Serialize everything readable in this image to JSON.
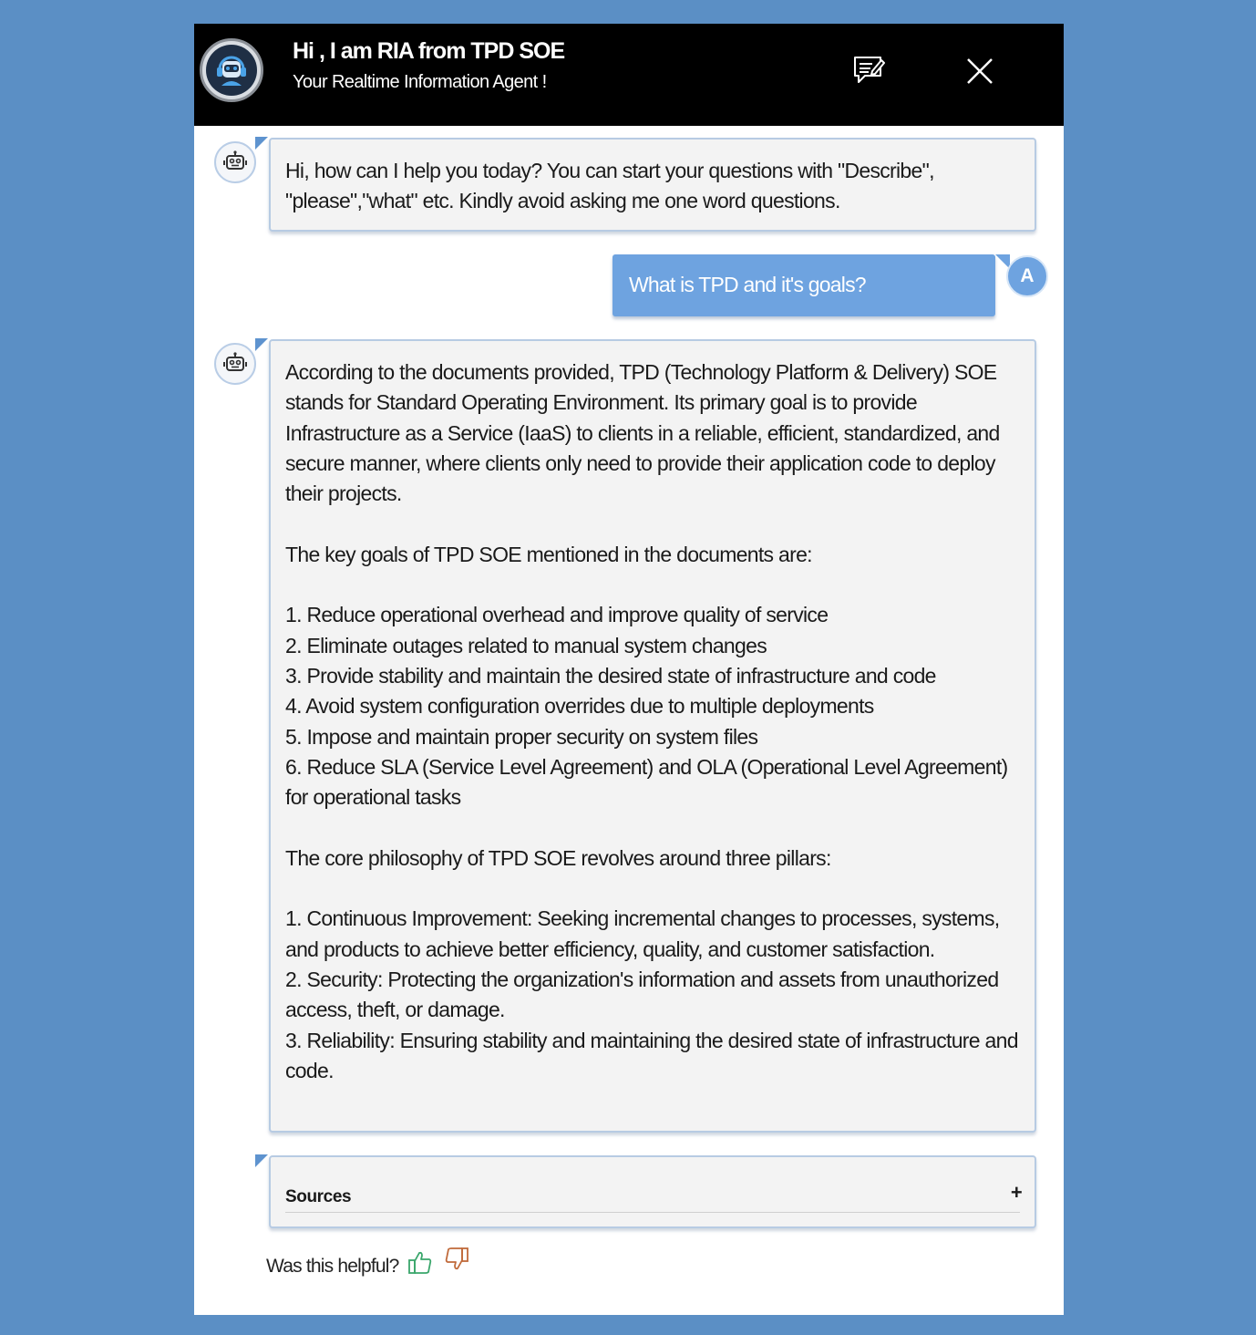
{
  "header": {
    "title": "Hi , I am RIA from TPD SOE",
    "subtitle": "Your Realtime Information Agent !"
  },
  "messages": {
    "greeting": "Hi, how can I help you today? You can start your questions with \"Describe\", \"please\",\"what\" etc. Kindly avoid asking me one word questions.",
    "user_question": "What is TPD and it's goals?",
    "user_avatar_letter": "A",
    "answer": "According to the documents provided, TPD (Technology Platform & Delivery) SOE stands for Standard Operating Environment. Its primary goal is to provide Infrastructure as a Service (IaaS) to clients in a reliable, efficient, standardized, and secure manner, where clients only need to provide their application code to deploy their projects.\n\nThe key goals of TPD SOE mentioned in the documents are:\n\n1. Reduce operational overhead and improve quality of service\n2. Eliminate outages related to manual system changes\n3. Provide stability and maintain the desired state of infrastructure and code\n4. Avoid system configuration overrides due to multiple deployments\n5. Impose and maintain proper security on system files\n6. Reduce SLA (Service Level Agreement) and OLA (Operational Level Agreement) for operational tasks\n\nThe core philosophy of TPD SOE revolves around three pillars:\n\n1. Continuous Improvement: Seeking incremental changes to processes, systems, and products to achieve better efficiency, quality, and customer satisfaction.\n2. Security: Protecting the organization's information and assets from unauthorized access, theft, or damage.\n3. Reliability: Ensuring stability and maintaining the desired state of infrastructure and code."
  },
  "sources": {
    "label": "Sources",
    "toggle": "+"
  },
  "feedback": {
    "question": "Was this helpful?"
  },
  "icons": {
    "header_avatar": "robot-headset-icon",
    "notes": "notes-icon",
    "close": "close-icon",
    "bot": "robot-icon",
    "thumbs_up": "thumbs-up-icon",
    "thumbs_down": "thumbs-down-icon"
  },
  "colors": {
    "background": "#5b8fc5",
    "header": "#000000",
    "user_bubble": "#6ea3e0",
    "bubble_border": "#b7cbe3",
    "thumbs_up": "#3aa66b",
    "thumbs_down": "#c06a3a"
  }
}
